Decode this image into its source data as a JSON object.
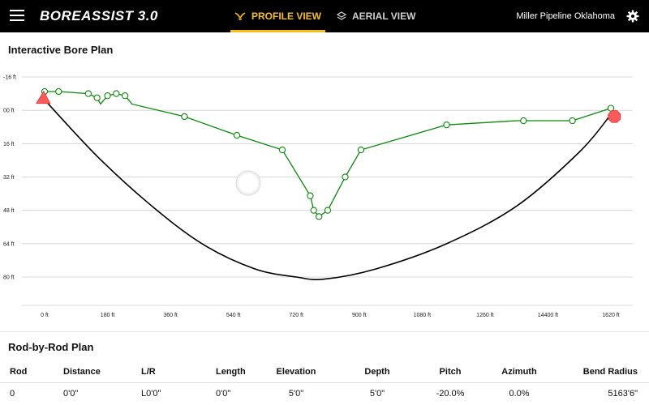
{
  "header": {
    "app_title": "BOREASSIST 3.0",
    "tabs": [
      {
        "label": "PROFILE VIEW",
        "active": true
      },
      {
        "label": "AERIAL VIEW",
        "active": false
      }
    ],
    "company": "Miller Pipeline Oklahoma"
  },
  "bore_plan": {
    "title": "Interactive Bore Plan"
  },
  "colors": {
    "planned_path": "#0a8a0a",
    "bore_path": "#000000",
    "entry_marker": "#ff5a5a",
    "exit_marker": "#ff5a5a",
    "active_tab": "#f5c010"
  },
  "chart_data": {
    "type": "line",
    "x_ticks": [
      "0 ft",
      "180 ft",
      "360 ft",
      "540 ft",
      "720 ft",
      "900 ft",
      "1080 ft",
      "1260 ft",
      "14400 ft",
      "1620 ft"
    ],
    "y_ticks": [
      "-16 ft",
      "00 ft",
      "16 ft",
      "32 ft",
      "48 ft",
      "64 ft",
      "80 ft"
    ],
    "xlim": [
      0,
      1620
    ],
    "ylim": [
      -16,
      80
    ],
    "y_inverted": true,
    "grid": true,
    "series": [
      {
        "kind": "planned",
        "points": [
          [
            0,
            -9
          ],
          [
            40,
            -9
          ],
          [
            125,
            -8
          ],
          [
            150,
            -6
          ],
          [
            160,
            -3
          ],
          [
            180,
            -7
          ],
          [
            205,
            -8
          ],
          [
            230,
            -7
          ],
          [
            250,
            -3
          ],
          [
            400,
            3
          ],
          [
            550,
            12
          ],
          [
            680,
            19
          ],
          [
            760,
            41
          ],
          [
            770,
            48
          ],
          [
            785,
            51
          ],
          [
            810,
            48
          ],
          [
            860,
            32
          ],
          [
            905,
            19
          ],
          [
            1150,
            7
          ],
          [
            1350,
            5
          ],
          [
            1510,
            5
          ],
          [
            1620,
            -1
          ]
        ],
        "markers": [
          [
            0,
            -9
          ],
          [
            40,
            -9
          ],
          [
            125,
            -8
          ],
          [
            150,
            -6
          ],
          [
            180,
            -7
          ],
          [
            205,
            -8
          ],
          [
            230,
            -7
          ],
          [
            400,
            3
          ],
          [
            550,
            12
          ],
          [
            680,
            19
          ],
          [
            760,
            41
          ],
          [
            770,
            48
          ],
          [
            785,
            51
          ],
          [
            810,
            48
          ],
          [
            860,
            32
          ],
          [
            905,
            19
          ],
          [
            1150,
            7
          ],
          [
            1370,
            5
          ],
          [
            1510,
            5
          ],
          [
            1620,
            -1
          ]
        ]
      },
      {
        "kind": "bore",
        "points": [
          [
            0,
            -5
          ],
          [
            150,
            22
          ],
          [
            300,
            45
          ],
          [
            450,
            64
          ],
          [
            600,
            76
          ],
          [
            720,
            80
          ],
          [
            800,
            81
          ],
          [
            950,
            76
          ],
          [
            1150,
            64
          ],
          [
            1350,
            46
          ],
          [
            1530,
            20
          ],
          [
            1620,
            2
          ]
        ]
      }
    ],
    "entry_point": [
      -5,
      -6
    ],
    "exit_point": [
      1630,
      3
    ]
  },
  "rod_plan": {
    "title": "Rod-by-Rod Plan",
    "columns": [
      "Rod",
      "Distance",
      "L/R",
      "Length",
      "Elevation",
      "Depth",
      "Pitch",
      "Azimuth",
      "Bend Radius"
    ],
    "rows": [
      [
        "0",
        "0'0\"",
        "L0'0\"",
        "0'0\"",
        "5'0\"",
        "5'0\"",
        "-20.0%",
        "0.0%",
        "5163'6\""
      ]
    ]
  }
}
